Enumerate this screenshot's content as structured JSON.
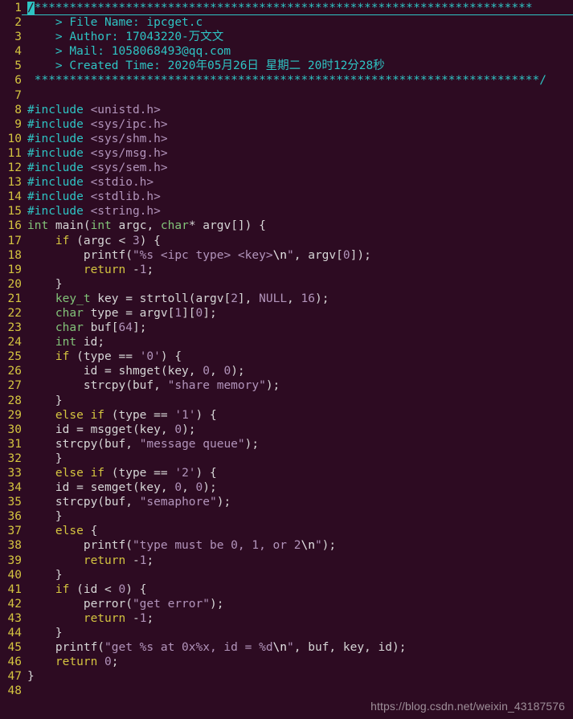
{
  "editor": {
    "background_color": "#2d0b22",
    "linenumber_color": "#d4c440",
    "comment_color": "#2ec4c4",
    "string_color": "#b294bb",
    "type_color": "#82c379",
    "keyword_color": "#d4c440",
    "text_color": "#d6d6d6",
    "file_name": "ipcget.c"
  },
  "watermark": {
    "text": "https://blog.csdn.net/weixin_43187576"
  },
  "lines": [
    {
      "n": "1",
      "text": "/************************************************************************"
    },
    {
      "n": "2",
      "text": "    > File Name: ipcget.c"
    },
    {
      "n": "3",
      "text": "    > Author: 17043220-万文文"
    },
    {
      "n": "4",
      "text": "    > Mail: 1058068493@qq.com"
    },
    {
      "n": "5",
      "text": "    > Created Time: 2020年05月26日 星期二 20时12分28秒"
    },
    {
      "n": "6",
      "text": " ************************************************************************/"
    },
    {
      "n": "7",
      "text": ""
    },
    {
      "n": "8",
      "text": "#include <unistd.h>"
    },
    {
      "n": "9",
      "text": "#include <sys/ipc.h>"
    },
    {
      "n": "10",
      "text": "#include <sys/shm.h>"
    },
    {
      "n": "11",
      "text": "#include <sys/msg.h>"
    },
    {
      "n": "12",
      "text": "#include <sys/sem.h>"
    },
    {
      "n": "13",
      "text": "#include <stdio.h>"
    },
    {
      "n": "14",
      "text": "#include <stdlib.h>"
    },
    {
      "n": "15",
      "text": "#include <string.h>"
    },
    {
      "n": "16",
      "text": "int main(int argc, char* argv[]) {"
    },
    {
      "n": "17",
      "text": "    if (argc < 3) {"
    },
    {
      "n": "18",
      "text": "        printf(\"%s <ipc type> <key>\\n\", argv[0]);"
    },
    {
      "n": "19",
      "text": "        return -1;"
    },
    {
      "n": "20",
      "text": "    }"
    },
    {
      "n": "21",
      "text": "    key_t key = strtoll(argv[2], NULL, 16);"
    },
    {
      "n": "22",
      "text": "    char type = argv[1][0];"
    },
    {
      "n": "23",
      "text": "    char buf[64];"
    },
    {
      "n": "24",
      "text": "    int id;"
    },
    {
      "n": "25",
      "text": "    if (type == '0') {"
    },
    {
      "n": "26",
      "text": "        id = shmget(key, 0, 0);"
    },
    {
      "n": "27",
      "text": "        strcpy(buf, \"share memory\");"
    },
    {
      "n": "28",
      "text": "    }"
    },
    {
      "n": "29",
      "text": "    else if (type == '1') {"
    },
    {
      "n": "30",
      "text": "    id = msgget(key, 0);"
    },
    {
      "n": "31",
      "text": "    strcpy(buf, \"message queue\");"
    },
    {
      "n": "32",
      "text": "    }"
    },
    {
      "n": "33",
      "text": "    else if (type == '2') {"
    },
    {
      "n": "34",
      "text": "    id = semget(key, 0, 0);"
    },
    {
      "n": "35",
      "text": "    strcpy(buf, \"semaphore\");"
    },
    {
      "n": "36",
      "text": "    }"
    },
    {
      "n": "37",
      "text": "    else {"
    },
    {
      "n": "38",
      "text": "        printf(\"type must be 0, 1, or 2\\n\");"
    },
    {
      "n": "39",
      "text": "        return -1;"
    },
    {
      "n": "40",
      "text": "    }"
    },
    {
      "n": "41",
      "text": "    if (id < 0) {"
    },
    {
      "n": "42",
      "text": "        perror(\"get error\");"
    },
    {
      "n": "43",
      "text": "        return -1;"
    },
    {
      "n": "44",
      "text": "    }"
    },
    {
      "n": "45",
      "text": "    printf(\"get %s at 0x%x, id = %d\\n\", buf, key, id);"
    },
    {
      "n": "46",
      "text": "    return 0;"
    },
    {
      "n": "47",
      "text": "}"
    },
    {
      "n": "48",
      "text": ""
    }
  ],
  "tokens": {
    "1": [
      {
        "c": "cursor cmt",
        "t": "/"
      },
      {
        "c": "cmt",
        "t": "***********************************************************************"
      }
    ],
    "2": [
      {
        "c": "cmt",
        "t": "    > File Name: ipcget.c"
      }
    ],
    "3": [
      {
        "c": "cmt",
        "t": "    > Author: 17043220-万文文"
      }
    ],
    "4": [
      {
        "c": "cmt",
        "t": "    > Mail: 1058068493@qq.com"
      }
    ],
    "5": [
      {
        "c": "cmt",
        "t": "    > Created Time: 2020年05月26日 星期二 20时12分28秒"
      }
    ],
    "6": [
      {
        "c": "cmt",
        "t": " ************************************************************************/"
      }
    ],
    "7": [],
    "8": [
      {
        "c": "pre",
        "t": "#include "
      },
      {
        "c": "hdr",
        "t": "<unistd.h>"
      }
    ],
    "9": [
      {
        "c": "pre",
        "t": "#include "
      },
      {
        "c": "hdr",
        "t": "<sys/ipc.h>"
      }
    ],
    "10": [
      {
        "c": "pre",
        "t": "#include "
      },
      {
        "c": "hdr",
        "t": "<sys/shm.h>"
      }
    ],
    "11": [
      {
        "c": "pre",
        "t": "#include "
      },
      {
        "c": "hdr",
        "t": "<sys/msg.h>"
      }
    ],
    "12": [
      {
        "c": "pre",
        "t": "#include "
      },
      {
        "c": "hdr",
        "t": "<sys/sem.h>"
      }
    ],
    "13": [
      {
        "c": "pre",
        "t": "#include "
      },
      {
        "c": "hdr",
        "t": "<stdio.h>"
      }
    ],
    "14": [
      {
        "c": "pre",
        "t": "#include "
      },
      {
        "c": "hdr",
        "t": "<stdlib.h>"
      }
    ],
    "15": [
      {
        "c": "pre",
        "t": "#include "
      },
      {
        "c": "hdr",
        "t": "<string.h>"
      }
    ],
    "16": [
      {
        "c": "type",
        "t": "int"
      },
      {
        "c": "id",
        "t": " main("
      },
      {
        "c": "type",
        "t": "int"
      },
      {
        "c": "id",
        "t": " argc, "
      },
      {
        "c": "type",
        "t": "char"
      },
      {
        "c": "id",
        "t": "* argv[]) {"
      }
    ],
    "17": [
      {
        "c": "id",
        "t": "    "
      },
      {
        "c": "kw",
        "t": "if"
      },
      {
        "c": "id",
        "t": " (argc < "
      },
      {
        "c": "num",
        "t": "3"
      },
      {
        "c": "id",
        "t": ") {"
      }
    ],
    "18": [
      {
        "c": "id",
        "t": "        printf("
      },
      {
        "c": "str",
        "t": "\"%s <ipc type> <key>"
      },
      {
        "c": "esc",
        "t": "\\n"
      },
      {
        "c": "str",
        "t": "\""
      },
      {
        "c": "id",
        "t": ", argv["
      },
      {
        "c": "num",
        "t": "0"
      },
      {
        "c": "id",
        "t": "]);"
      }
    ],
    "19": [
      {
        "c": "id",
        "t": "        "
      },
      {
        "c": "kw",
        "t": "return"
      },
      {
        "c": "id",
        "t": " -"
      },
      {
        "c": "num",
        "t": "1"
      },
      {
        "c": "id",
        "t": ";"
      }
    ],
    "20": [
      {
        "c": "id",
        "t": "    }"
      }
    ],
    "21": [
      {
        "c": "id",
        "t": "    "
      },
      {
        "c": "type",
        "t": "key_t"
      },
      {
        "c": "id",
        "t": " key = strtoll(argv["
      },
      {
        "c": "num",
        "t": "2"
      },
      {
        "c": "id",
        "t": "], "
      },
      {
        "c": "cnst",
        "t": "NULL"
      },
      {
        "c": "id",
        "t": ", "
      },
      {
        "c": "num",
        "t": "16"
      },
      {
        "c": "id",
        "t": ");"
      }
    ],
    "22": [
      {
        "c": "id",
        "t": "    "
      },
      {
        "c": "type",
        "t": "char"
      },
      {
        "c": "id",
        "t": " type = argv["
      },
      {
        "c": "num",
        "t": "1"
      },
      {
        "c": "id",
        "t": "]["
      },
      {
        "c": "num",
        "t": "0"
      },
      {
        "c": "id",
        "t": "];"
      }
    ],
    "23": [
      {
        "c": "id",
        "t": "    "
      },
      {
        "c": "type",
        "t": "char"
      },
      {
        "c": "id",
        "t": " buf["
      },
      {
        "c": "num",
        "t": "64"
      },
      {
        "c": "id",
        "t": "];"
      }
    ],
    "24": [
      {
        "c": "id",
        "t": "    "
      },
      {
        "c": "type",
        "t": "int"
      },
      {
        "c": "id",
        "t": " id;"
      }
    ],
    "25": [
      {
        "c": "id",
        "t": "    "
      },
      {
        "c": "kw",
        "t": "if"
      },
      {
        "c": "id",
        "t": " (type == "
      },
      {
        "c": "str",
        "t": "'0'"
      },
      {
        "c": "id",
        "t": ") {"
      }
    ],
    "26": [
      {
        "c": "id",
        "t": "        id = shmget(key, "
      },
      {
        "c": "num",
        "t": "0"
      },
      {
        "c": "id",
        "t": ", "
      },
      {
        "c": "num",
        "t": "0"
      },
      {
        "c": "id",
        "t": ");"
      }
    ],
    "27": [
      {
        "c": "id",
        "t": "        strcpy(buf, "
      },
      {
        "c": "str",
        "t": "\"share memory\""
      },
      {
        "c": "id",
        "t": ");"
      }
    ],
    "28": [
      {
        "c": "id",
        "t": "    }"
      }
    ],
    "29": [
      {
        "c": "id",
        "t": "    "
      },
      {
        "c": "kw",
        "t": "else if"
      },
      {
        "c": "id",
        "t": " (type == "
      },
      {
        "c": "str",
        "t": "'1'"
      },
      {
        "c": "id",
        "t": ") {"
      }
    ],
    "30": [
      {
        "c": "id",
        "t": "    id = msgget(key, "
      },
      {
        "c": "num",
        "t": "0"
      },
      {
        "c": "id",
        "t": ");"
      }
    ],
    "31": [
      {
        "c": "id",
        "t": "    strcpy(buf, "
      },
      {
        "c": "str",
        "t": "\"message queue\""
      },
      {
        "c": "id",
        "t": ");"
      }
    ],
    "32": [
      {
        "c": "id",
        "t": "    }"
      }
    ],
    "33": [
      {
        "c": "id",
        "t": "    "
      },
      {
        "c": "kw",
        "t": "else if"
      },
      {
        "c": "id",
        "t": " (type == "
      },
      {
        "c": "str",
        "t": "'2'"
      },
      {
        "c": "id",
        "t": ") {"
      }
    ],
    "34": [
      {
        "c": "id",
        "t": "    id = semget(key, "
      },
      {
        "c": "num",
        "t": "0"
      },
      {
        "c": "id",
        "t": ", "
      },
      {
        "c": "num",
        "t": "0"
      },
      {
        "c": "id",
        "t": ");"
      }
    ],
    "35": [
      {
        "c": "id",
        "t": "    strcpy(buf, "
      },
      {
        "c": "str",
        "t": "\"semaphore\""
      },
      {
        "c": "id",
        "t": ");"
      }
    ],
    "36": [
      {
        "c": "id",
        "t": "    }"
      }
    ],
    "37": [
      {
        "c": "id",
        "t": "    "
      },
      {
        "c": "kw",
        "t": "else"
      },
      {
        "c": "id",
        "t": " {"
      }
    ],
    "38": [
      {
        "c": "id",
        "t": "        printf("
      },
      {
        "c": "str",
        "t": "\"type must be 0, 1, or 2"
      },
      {
        "c": "esc",
        "t": "\\n"
      },
      {
        "c": "str",
        "t": "\""
      },
      {
        "c": "id",
        "t": ");"
      }
    ],
    "39": [
      {
        "c": "id",
        "t": "        "
      },
      {
        "c": "kw",
        "t": "return"
      },
      {
        "c": "id",
        "t": " -"
      },
      {
        "c": "num",
        "t": "1"
      },
      {
        "c": "id",
        "t": ";"
      }
    ],
    "40": [
      {
        "c": "id",
        "t": "    }"
      }
    ],
    "41": [
      {
        "c": "id",
        "t": "    "
      },
      {
        "c": "kw",
        "t": "if"
      },
      {
        "c": "id",
        "t": " (id < "
      },
      {
        "c": "num",
        "t": "0"
      },
      {
        "c": "id",
        "t": ") {"
      }
    ],
    "42": [
      {
        "c": "id",
        "t": "        perror("
      },
      {
        "c": "str",
        "t": "\"get error\""
      },
      {
        "c": "id",
        "t": ");"
      }
    ],
    "43": [
      {
        "c": "id",
        "t": "        "
      },
      {
        "c": "kw",
        "t": "return"
      },
      {
        "c": "id",
        "t": " -"
      },
      {
        "c": "num",
        "t": "1"
      },
      {
        "c": "id",
        "t": ";"
      }
    ],
    "44": [
      {
        "c": "id",
        "t": "    }"
      }
    ],
    "45": [
      {
        "c": "id",
        "t": "    printf("
      },
      {
        "c": "str",
        "t": "\"get %s at 0x%x, id = %d"
      },
      {
        "c": "esc",
        "t": "\\n"
      },
      {
        "c": "str",
        "t": "\""
      },
      {
        "c": "id",
        "t": ", buf, key, id);"
      }
    ],
    "46": [
      {
        "c": "id",
        "t": "    "
      },
      {
        "c": "kw",
        "t": "return"
      },
      {
        "c": "id",
        "t": " "
      },
      {
        "c": "num",
        "t": "0"
      },
      {
        "c": "id",
        "t": ";"
      }
    ],
    "47": [
      {
        "c": "id",
        "t": "}"
      }
    ],
    "48": []
  }
}
